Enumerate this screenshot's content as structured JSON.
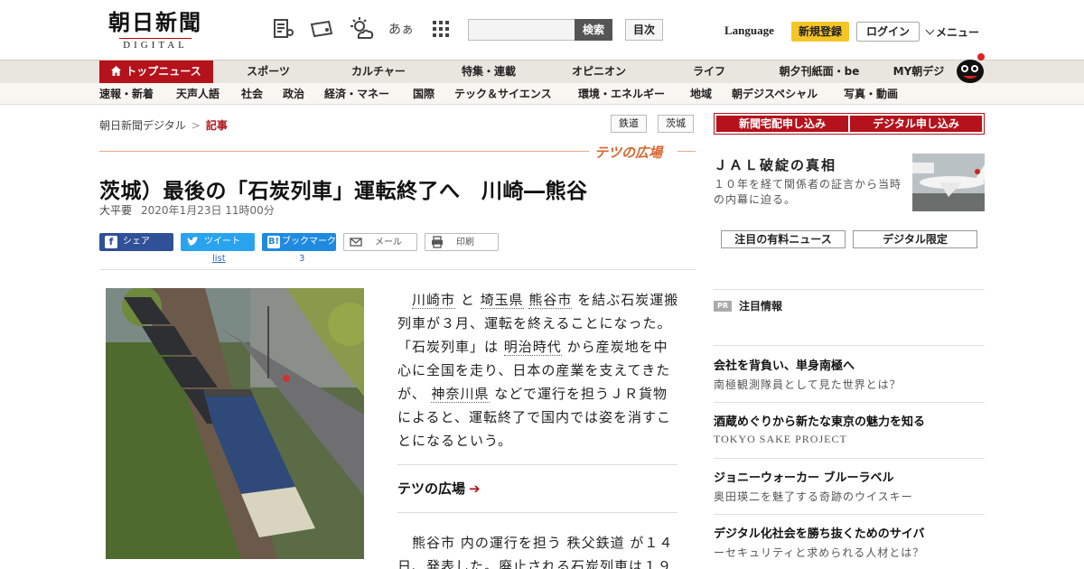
{
  "header": {
    "logo_main": "朝日新聞",
    "logo_sub": "DIGITAL",
    "search_button": "検索",
    "toc_button": "目次",
    "language": "Language",
    "signup": "新規登録",
    "login": "ログイン",
    "menu": "メニュー",
    "moji_icon_text": "あぁ"
  },
  "nav_primary": [
    "トップニュース",
    "スポーツ",
    "カルチャー",
    "特集・連載",
    "オピニオン",
    "ライフ",
    "朝夕刊紙面・be",
    "MY朝デジ"
  ],
  "nav_secondary": [
    "速報・新着",
    "天声人語",
    "社会",
    "政治",
    "経済・マネー",
    "国際",
    "テック＆サイエンス",
    "環境・エネルギー",
    "地域",
    "朝デジスペシャル",
    "写真・動画"
  ],
  "breadcrumb": {
    "home": "朝日新聞デジタル",
    "current": "記事"
  },
  "tags": [
    "鉄道",
    "茨城"
  ],
  "series_label": "テツの広場",
  "article": {
    "title": "茨城）最後の「石炭列車」運転終了へ　川崎―熊谷",
    "author": "大平要",
    "date": "2020年1月23日 11時00分",
    "p1_links": [
      "川崎市",
      "埼玉県",
      "熊谷市",
      "明治時代",
      "神奈川県"
    ],
    "p1_parts": [
      "と",
      "を結ぶ石炭運搬列車が３月、運転を終えることになった。「石炭列車」は",
      "から産炭地を中心に全国を走り、日本の産業を支えてきたが、",
      "などで運行を担うＪＲ貨物によると、運転終了で国内では姿を消すことになるという。"
    ],
    "related_label": "テツの広場",
    "p2_links": [
      "熊谷市",
      "秩父鉄道"
    ],
    "p2_parts": [
      "内の運行を担う",
      "が１４日、発表した。廃止される石炭列車は１９"
    ]
  },
  "share": {
    "facebook": "シェア",
    "twitter": "ツイート",
    "twitter_count": "list",
    "hatena": "ブックマーク",
    "hatena_count": "3",
    "mail": "メール",
    "print": "印刷"
  },
  "sidebar": {
    "subscribe_paper": "新聞宅配申し込み",
    "subscribe_digital": "デジタル申し込み",
    "feature_title": "ＪＡＬ破綻の真相",
    "feature_desc": "１０年を経て関係者の証言から当時の内幕に迫る。",
    "pill_left": "注目の有料ニュース",
    "pill_right": "デジタル限定",
    "pr_badge": "PR",
    "pr_head": "注目情報",
    "ads": [
      {
        "title": "会社を背負い、単身南極へ",
        "sub": "南極観測隊員として見た世界とは？"
      },
      {
        "title": "酒蔵めぐりから新たな東京の魅力を知る",
        "sub": "TOKYO SAKE PROJECT"
      },
      {
        "title": "ジョニーウォーカー ブルーラベル",
        "sub": "奥田瑛二を魅了する奇跡のウイスキー"
      },
      {
        "title": "デジタル化社会を勝ち抜くためのサイバ",
        "sub": "ーセキュリティと求められる人材とは？"
      }
    ]
  },
  "colors": {
    "brand_red": "#b5121b",
    "signup_yellow": "#f5c526",
    "series_orange": "#d9662f"
  }
}
